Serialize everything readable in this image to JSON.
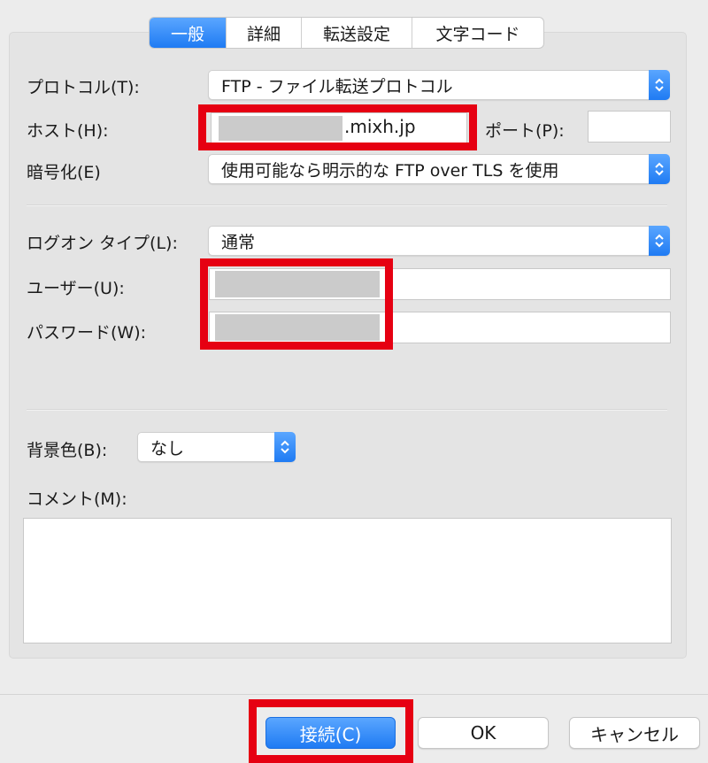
{
  "tabs": [
    {
      "label": "一般",
      "active": true
    },
    {
      "label": "詳細",
      "active": false
    },
    {
      "label": "転送設定",
      "active": false
    },
    {
      "label": "文字コード",
      "active": false
    }
  ],
  "general": {
    "protocol_label": "プロトコル(T):",
    "protocol_value": "FTP - ファイル転送プロトコル",
    "host_label": "ホスト(H):",
    "host_value": ".mixh.jp",
    "port_label": "ポート(P):",
    "port_value": "",
    "encryption_label": "暗号化(E)",
    "encryption_value": "使用可能なら明示的な FTP over TLS を使用",
    "logon_type_label": "ログオン タイプ(L):",
    "logon_type_value": "通常",
    "user_label": "ユーザー(U):",
    "user_value": "",
    "password_label": "パスワード(W):",
    "password_value": "",
    "bg_color_label": "背景色(B):",
    "bg_color_value": "なし",
    "comment_label": "コメント(M):",
    "comment_value": ""
  },
  "buttons": {
    "connect": "接続(C)",
    "ok": "OK",
    "cancel": "キャンセル"
  },
  "colors": {
    "accent_blue": "#1f7bf3",
    "highlight_red": "#e60012"
  },
  "icons": {
    "select_chevron": "chevron-up-down-icon"
  }
}
